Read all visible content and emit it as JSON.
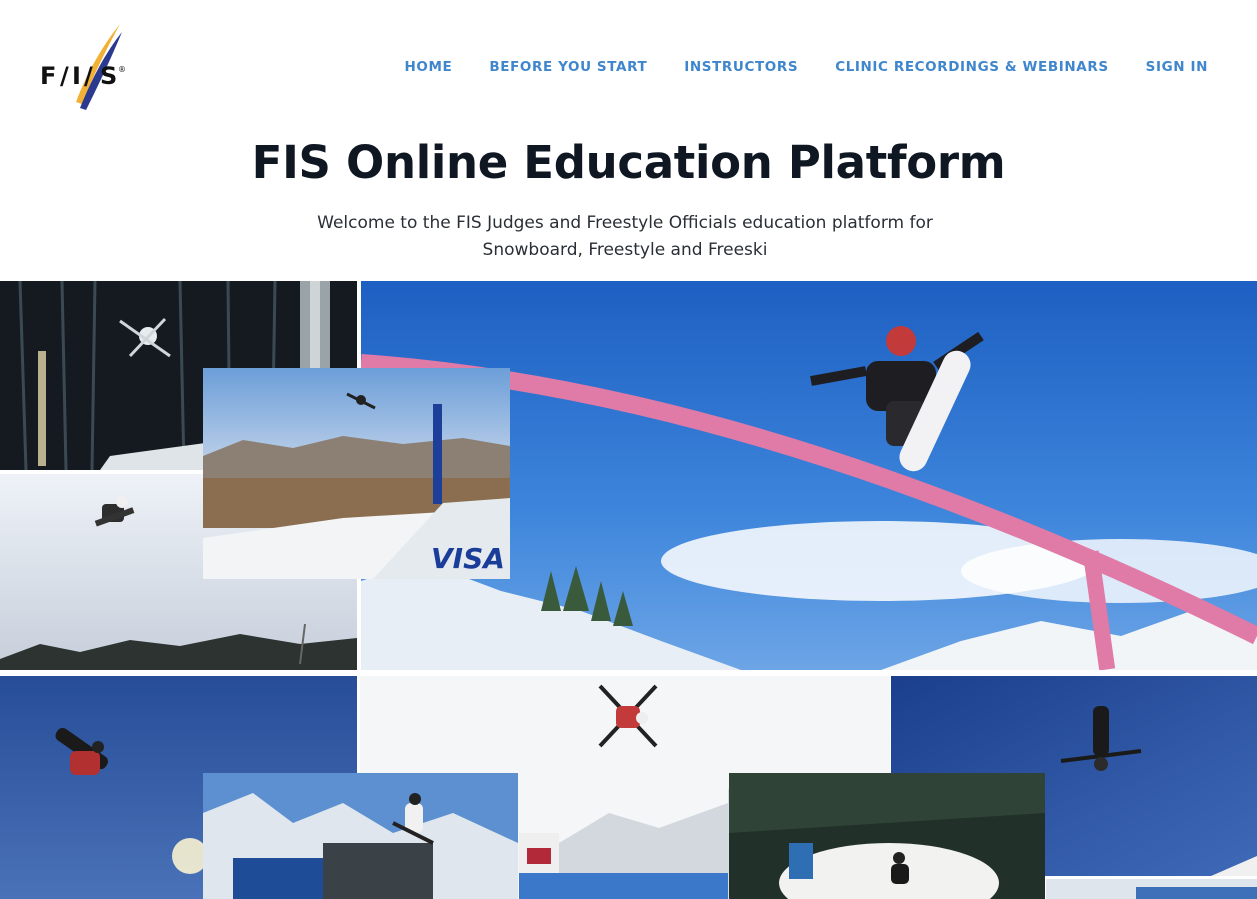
{
  "brand": {
    "logo_text": "FIS",
    "logo_icon": "fis-logo-icon",
    "colors": {
      "nav": "#3f86cd",
      "title": "#0f1722",
      "logo_yellow": "#f2b134",
      "logo_blue": "#2b3a8f"
    }
  },
  "nav": {
    "items": [
      {
        "label": "HOME"
      },
      {
        "label": "BEFORE YOU START"
      },
      {
        "label": "INSTRUCTORS"
      },
      {
        "label": "CLINIC RECORDINGS & WEBINARS"
      },
      {
        "label": "SIGN IN"
      }
    ]
  },
  "hero": {
    "title": "FIS Online Education Platform",
    "subtitle": "Welcome to the FIS Judges and Freestyle Officials  education platform for Snowboard, Freestyle and Freeski"
  },
  "collage": {
    "sponsor_text": "VISA"
  }
}
